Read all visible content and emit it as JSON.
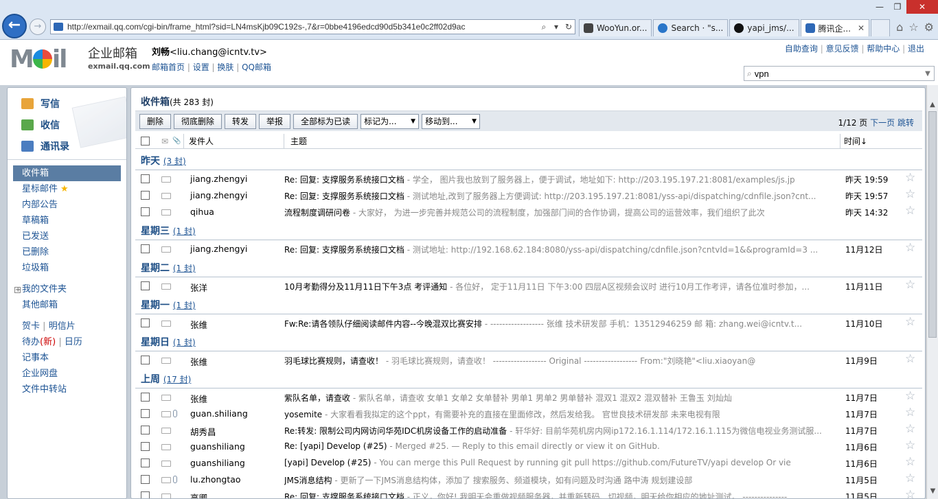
{
  "browser": {
    "url": "http://exmail.qq.com/cgi-bin/frame_html?sid=LN4msKjb09C192s-,7&r=0bbe4196edcd90d5b341e0c2ff02d9ac",
    "tabs": [
      {
        "label": "WooYun.or..."
      },
      {
        "label": "Search · \"s..."
      },
      {
        "label": "yapi_jms/..."
      },
      {
        "label": "腾讯企..."
      }
    ],
    "win": {
      "min": "—",
      "max": "❐",
      "close": "✕"
    }
  },
  "header": {
    "brand_cn": "企业邮箱",
    "brand_en": "exmail.qq.com",
    "user_name": "刘畅",
    "user_email": "<liu.chang@icntv.tv>",
    "user_links": [
      "邮箱首页",
      "设置",
      "换肤",
      "QQ邮箱"
    ],
    "top_links": [
      "自助查询",
      "意见反馈",
      "帮助中心",
      "退出"
    ],
    "search_value": "vpn"
  },
  "sidebar": {
    "quick": [
      "写信",
      "收信",
      "通讯录"
    ],
    "folders": [
      "收件箱",
      "星标邮件",
      "内部公告",
      "草稿箱",
      "已发送",
      "已删除",
      "垃圾箱"
    ],
    "my_folders": "我的文件夹",
    "other_mail": "其他邮箱",
    "tools": {
      "card": "贺卡",
      "postcard": "明信片",
      "todo": "待办",
      "todo_new": "(新)",
      "calendar": "日历",
      "notes": "记事本",
      "disk": "企业网盘",
      "transfer": "文件中转站"
    }
  },
  "inbox": {
    "title": "收件箱",
    "count": "(共 283 封)",
    "toolbar": {
      "delete": "删除",
      "delete_perm": "彻底删除",
      "forward": "转发",
      "report": "举报",
      "mark_all_read": "全部标为已读",
      "mark_as": "标记为...",
      "move_to": "移动到..."
    },
    "pager": {
      "page": "1/12 页",
      "next": "下一页",
      "jump": "跳转"
    },
    "columns": {
      "sender": "发件人",
      "subject": "主题",
      "time": "时间↓"
    },
    "groups": [
      {
        "label": "昨天",
        "count": "(3 封)",
        "rows": [
          {
            "sender": "jiang.zhengyi",
            "subject": "Re: 回复: 支撑服务系统接口文档",
            "summary": " - 学全，       图片我也放到了服务器上，便于调试，地址如下:  http://203.195.197.21:8081/examples/js.jp",
            "time": "昨天 19:59",
            "clip": false
          },
          {
            "sender": "jiang.zhengyi",
            "subject": "Re: 回复: 支撑服务系统接口文档",
            "summary": " - 测试地址,改到了服务器上方便调试:   http://203.195.197.21:8081/yss-api/dispatching/cdnfile.json?cnt...",
            "time": "昨天 19:57",
            "clip": false
          },
          {
            "sender": "qihua",
            "subject": "流程制度调研问卷",
            "summary": " - 大家好，   为进一步完善并规范公司的流程制度，加强部门间的合作协调，提高公司的运营效率，我们组织了此次",
            "time": "昨天 14:32",
            "clip": false
          }
        ]
      },
      {
        "label": "星期三",
        "count": "(1 封)",
        "rows": [
          {
            "sender": "jiang.zhengyi",
            "subject": "Re: 回复: 支撑服务系统接口文档",
            "summary": " - 测试地址:   http://192.168.62.184:8080/yss-api/dispatching/cdnfile.json?cntvId=1&&programId=3 ...",
            "time": "11月12日",
            "clip": false
          }
        ]
      },
      {
        "label": "星期二",
        "count": "(1 封)",
        "rows": [
          {
            "sender": "张洋",
            "subject": "10月考勤得分及11月11日下午3点 考评通知",
            "summary": " - 各位好，         定于11月11日 下午3:00 四层A区视频会议时 进行10月工作考评，请各位准时参加，...",
            "time": "11月11日",
            "clip": false
          }
        ]
      },
      {
        "label": "星期一",
        "count": "(1 封)",
        "rows": [
          {
            "sender": "张维",
            "subject": "Fw:Re:请各领队仔细阅读邮件内容--今晚混双比赛安排",
            "summary": " - ------------------ 张维   技术研发部  手机：13512946259 邮 箱: zhang.wei@icntv.t...",
            "time": "11月10日",
            "clip": false
          }
        ]
      },
      {
        "label": "星期日",
        "count": "(1 封)",
        "rows": [
          {
            "sender": "张维",
            "subject": "羽毛球比赛规则，请查收！",
            "summary": " - 羽毛球比赛规则，请查收！    ------------------ Original ------------------ From:\"刘晓艳\"<liu.xiaoyan@",
            "time": "11月9日",
            "clip": false
          }
        ]
      },
      {
        "label": "上周",
        "count": "(17 封)",
        "rows": [
          {
            "sender": "张维",
            "subject": "紫队名单，请查收",
            "summary": " - 紫队名单，请查收       女单1 女单2 女单替补 男单1 男单2 男单替补 混双1 混双2 混双替补  王鲁玉 刘灿灿",
            "time": "11月7日",
            "clip": false
          },
          {
            "sender": "guan.shiliang",
            "subject": "yosemite",
            "summary": " - 大家看看我拟定的这个ppt，有需要补充的直接在里面修改，然后发给我。    官世良技术研发部    未来电视有限",
            "time": "11月7日",
            "clip": true
          },
          {
            "sender": "胡秀昌",
            "subject": "Re:转发: 限制公司内网访问华苑IDC机房设备工作的启动准备",
            "summary": " - 轩华好: 目前华苑机房内网ip172.16.1.114/172.16.1.115为微信电视业务测试服...",
            "time": "11月7日",
            "clip": false
          },
          {
            "sender": "guanshiliang",
            "subject": "Re: [yapi] Develop (#25)",
            "summary": " - Merged #25. — Reply to this email directly or view it on GitHub.",
            "time": "11月6日",
            "clip": false
          },
          {
            "sender": "guanshiliang",
            "subject": "[yapi] Develop (#25)",
            "summary": " - You can merge this Pull Request by running git pull https://github.com/FutureTV/yapi develop Or vie",
            "time": "11月6日",
            "clip": false
          },
          {
            "sender": "lu.zhongtao",
            "subject": "JMS消息结构",
            "summary": " - 更新了一下JMS消息结构体，添加了 搜索服务、频道模块，如有问题及时沟通        路中涛 规划建设部",
            "time": "11月5日",
            "clip": true
          },
          {
            "sender": "高卿",
            "subject": "Re: 回复: 支撑服务系统接口文档",
            "summary": " - 正义，你好!    我明天会重做视频服务器，并重新转码、切视频，明天给你相应的地址测试。  ---------------",
            "time": "11月5日",
            "clip": false
          }
        ]
      }
    ]
  }
}
